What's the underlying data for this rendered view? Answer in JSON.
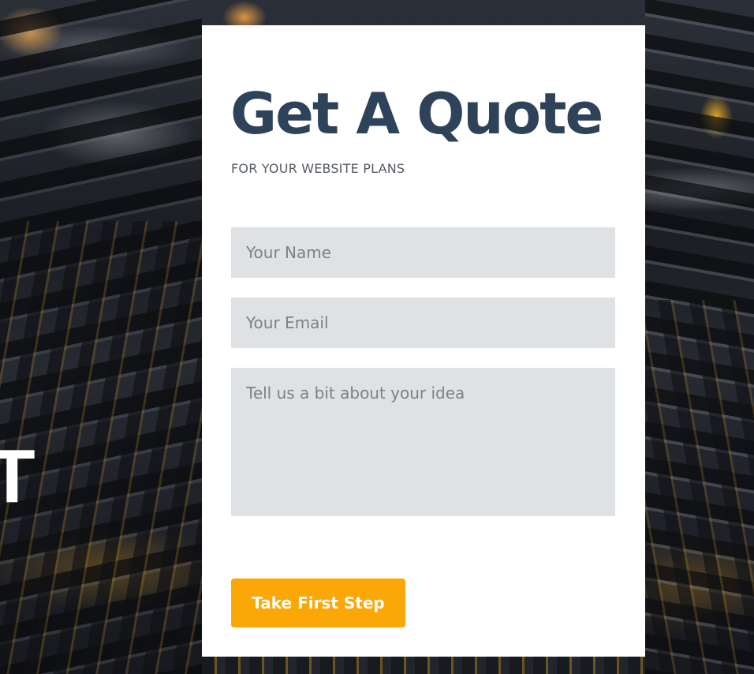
{
  "hero": {
    "fragment_text": "T"
  },
  "quote_form": {
    "title": "Get A Quote",
    "subtitle": "FOR YOUR WEBSITE PLANS",
    "name_placeholder": "Your Name",
    "email_placeholder": "Your Email",
    "idea_placeholder": "Tell us a bit about your idea",
    "submit_label": "Take First Step"
  },
  "colors": {
    "title": "#2e4259",
    "subtitle": "#555b63",
    "input_background": "#dfe2e5",
    "placeholder": "#7c8187",
    "button": "#fba707",
    "button_text": "#ffffff",
    "card_background": "#ffffff"
  }
}
